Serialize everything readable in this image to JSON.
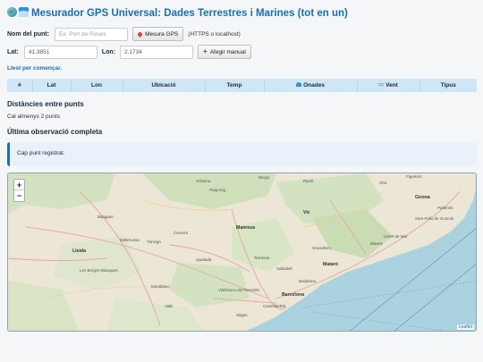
{
  "header": {
    "title": "Mesurador GPS Universal: Dades Terrestres i Marines (tot en un)",
    "icons": [
      "globe-icon",
      "wave-icon"
    ]
  },
  "point_form": {
    "name_label": "Nom del punt:",
    "name_placeholder": "Ex: Port de Roses",
    "measure_button": "Mesura GPS",
    "measure_hint": "(HTTPS o localhost)",
    "lat_label": "Lat:",
    "lat_value": "41.3851",
    "lon_label": "Lon:",
    "lon_value": "2.1734",
    "add_manual_button": "Afegir manual"
  },
  "status": "Llest per començar.",
  "table": {
    "columns": [
      "#",
      "Lat",
      "Lon",
      "Ubicació",
      "Temp",
      "Onades",
      "Vent",
      "Tipus"
    ]
  },
  "distances": {
    "heading": "Distàncies entre punts",
    "note": "Cal almenys 2 punts"
  },
  "last_observation": {
    "heading": "Última observació completa",
    "message": "Cap punt registrat."
  },
  "map": {
    "zoom_in": "+",
    "zoom_out": "−",
    "attribution": "Leaflet",
    "labels": {
      "solsona": "Solsona",
      "berga": "Berga",
      "ripoll": "Ripoll",
      "olot": "Olot",
      "girona": "Girona",
      "lleida": "Lleida",
      "manresa": "Manresa",
      "vic": "Vic",
      "tarrega": "Tàrrega",
      "cervera": "Cervera",
      "igualada": "Igualada",
      "terrassa": "Terrassa",
      "sabadell": "Sabadell",
      "mataro": "Mataró",
      "barcelona": "Barcelona",
      "badalona": "Badalona",
      "granollers": "Granollers",
      "balaguer": "Balaguer",
      "blanes": "Blanes",
      "lloret": "Lloret de Mar",
      "sant_feliu": "Sant Feliu de Guíxols",
      "palamos": "Palamós",
      "figueres": "Figueres",
      "montblanc": "Montblanc",
      "valls": "Valls",
      "vilafranca": "Vilafranca del Penedès",
      "sitges": "Sitges",
      "castelldefels": "Castelldefels",
      "borges": "Les Borges Blanques",
      "mollerussa": "Mollerussa",
      "puigcerda": "Puig-reig"
    }
  }
}
